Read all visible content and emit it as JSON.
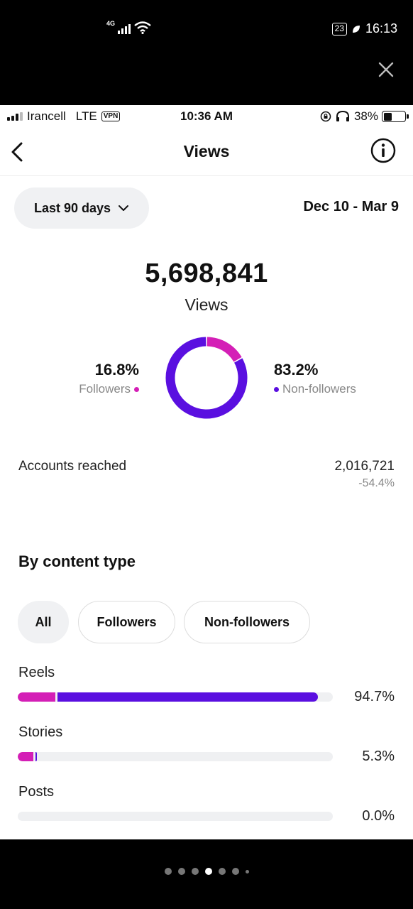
{
  "outer_status": {
    "network": "4G",
    "battery": "23",
    "time": "16:13",
    "close_icon": "close-icon"
  },
  "ios_status": {
    "carrier": "Irancell",
    "network": "LTE",
    "vpn": "VPN",
    "time": "10:36 AM",
    "battery": "38%",
    "battery_level": 0.38
  },
  "nav": {
    "title": "Views",
    "back_icon": "chevron-left-icon",
    "info_icon": "info-icon"
  },
  "range": {
    "selected": "Last 90 days",
    "dates": "Dec 10 - Mar 9"
  },
  "totals": {
    "value": "5,698,841",
    "label": "Views"
  },
  "split": {
    "followers_pct": "16.8%",
    "followers_label": "Followers",
    "followers_value": 16.8,
    "non_followers_pct": "83.2%",
    "non_followers_label": "Non-followers",
    "non_followers_value": 83.2,
    "colors": {
      "followers": "#d41fb6",
      "non_followers": "#5a0fe0"
    }
  },
  "accounts_reached": {
    "label": "Accounts reached",
    "value": "2,016,721",
    "change": "-54.4%"
  },
  "content_type": {
    "title": "By content type",
    "filters": [
      "All",
      "Followers",
      "Non-followers"
    ],
    "active_filter": "All",
    "rows": [
      {
        "label": "Reels",
        "pct": "94.7%",
        "followers_fraction": 0.12,
        "non_followers_fraction": 0.826
      },
      {
        "label": "Stories",
        "pct": "5.3%",
        "followers_fraction": 0.05,
        "non_followers_fraction": 0.003
      },
      {
        "label": "Posts",
        "pct": "0.0%",
        "followers_fraction": 0.0,
        "non_followers_fraction": 0.0
      }
    ]
  },
  "pager": {
    "count": 7,
    "active_index": 3
  }
}
